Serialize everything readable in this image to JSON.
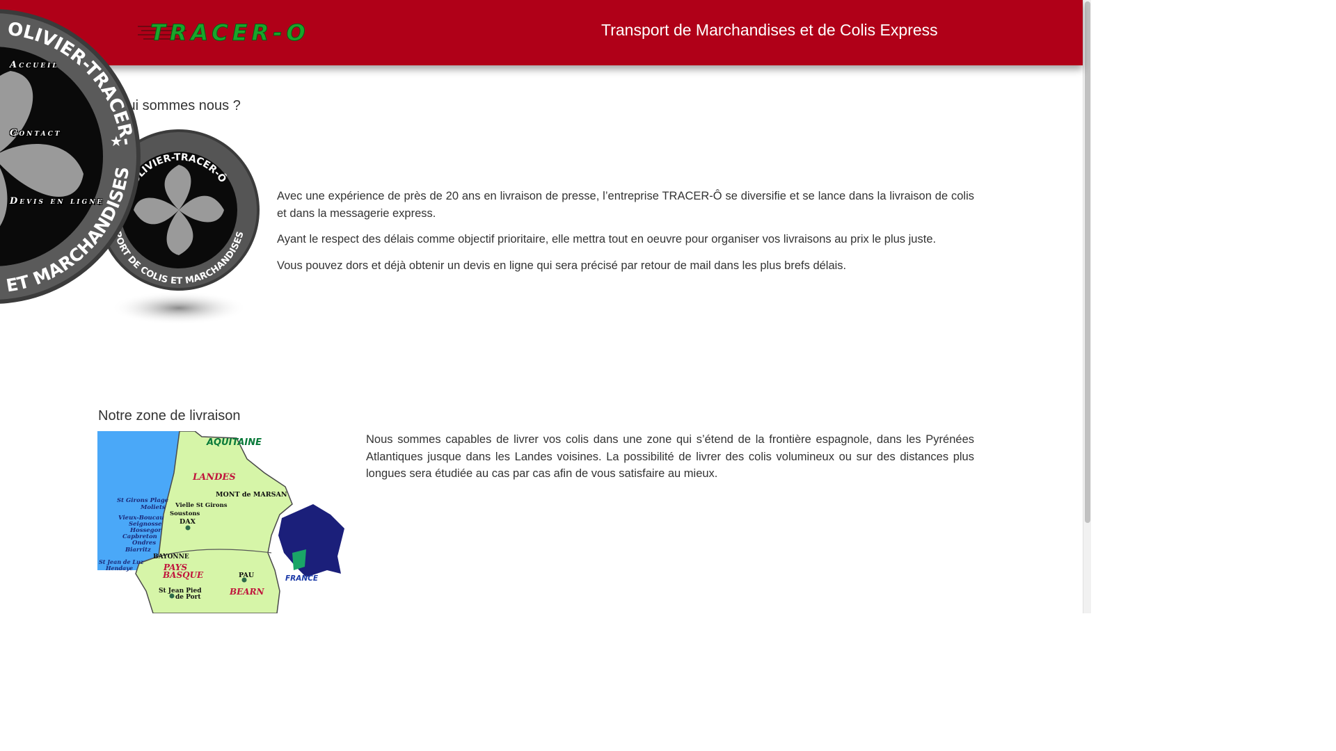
{
  "header": {
    "logo_text": "TRACER-O",
    "tagline": "Transport de Marchandises et de Colis Express"
  },
  "colors": {
    "header_bg": "#b00018",
    "logo_green": "#1aa52a",
    "text": "#333333",
    "map_sea": "#4aa8f8",
    "map_land": "#d6f5a8",
    "map_france": "#1b1f7a"
  },
  "nav": {
    "items": [
      {
        "label": "Accueil"
      },
      {
        "label": "Contact"
      },
      {
        "label": "Devis en ligne"
      }
    ]
  },
  "wheel": {
    "big_text_top": "OLIVIER-TRACER-Ô",
    "big_text_bottom": "ET MARCHANDISES",
    "small_text_top": "ART OLIVIER-TRACER-Ô",
    "small_text_bottom": "SPORT DE COLIS ET MARCHANDISES"
  },
  "about": {
    "title": "Qui sommes nous ?",
    "paragraphs": [
      "Avec une expérience de près de 20 ans en livraison de presse, l’entreprise TRACER-Ô se diversifie et se lance dans la livraison de colis et dans la messagerie express.",
      "Ayant le respect des délais comme objectif prioritaire, elle mettra tout en oeuvre pour organiser vos livraisons au prix le plus juste.",
      "Vous pouvez dors et déjà obtenir un devis en ligne qui sera précisé par retour de mail dans les plus brefs délais."
    ]
  },
  "zone": {
    "title": "Notre zone de livraison",
    "paragraph": "Nous sommes capables de livrer vos colis dans une zone qui s’étend de la frontière espagnole, dans les Pyrénées Atlantiques jusque dans les Landes voisines. La possibilité de livrer des colis volumineux ou sur des distances plus longues sera étudiée au cas par cas afin de vous satisfaire au mieux."
  },
  "map": {
    "region": "AQUITAINE",
    "landes": "LANDES",
    "pays_basque": [
      "PAYS",
      "BASQUE"
    ],
    "bearn": "BEARN",
    "france": "FRANCE",
    "towns": {
      "mont_de_marsan": "MONT de MARSAN",
      "st_girons_plage": "St Girons Plage",
      "moliets": "Moliets",
      "vielle_st_girons": "Vielle St Girons",
      "soustons": "Soustons",
      "dax": "DAX",
      "vieux_boucau": "Vieux-Boucau",
      "seignosse": "Seignosse",
      "hossegor": "Hossegor",
      "capbreton": "Capbreton",
      "ondres": "Ondres",
      "biarritz": "Biarritz",
      "bayonne": "BAYONNE",
      "st_jean_de_luz": "St Jean de Luz",
      "hendaye": "Hendaye",
      "pau": "PAU",
      "st_jean_pied": "St Jean Pied",
      "de_port": "de Port"
    }
  }
}
